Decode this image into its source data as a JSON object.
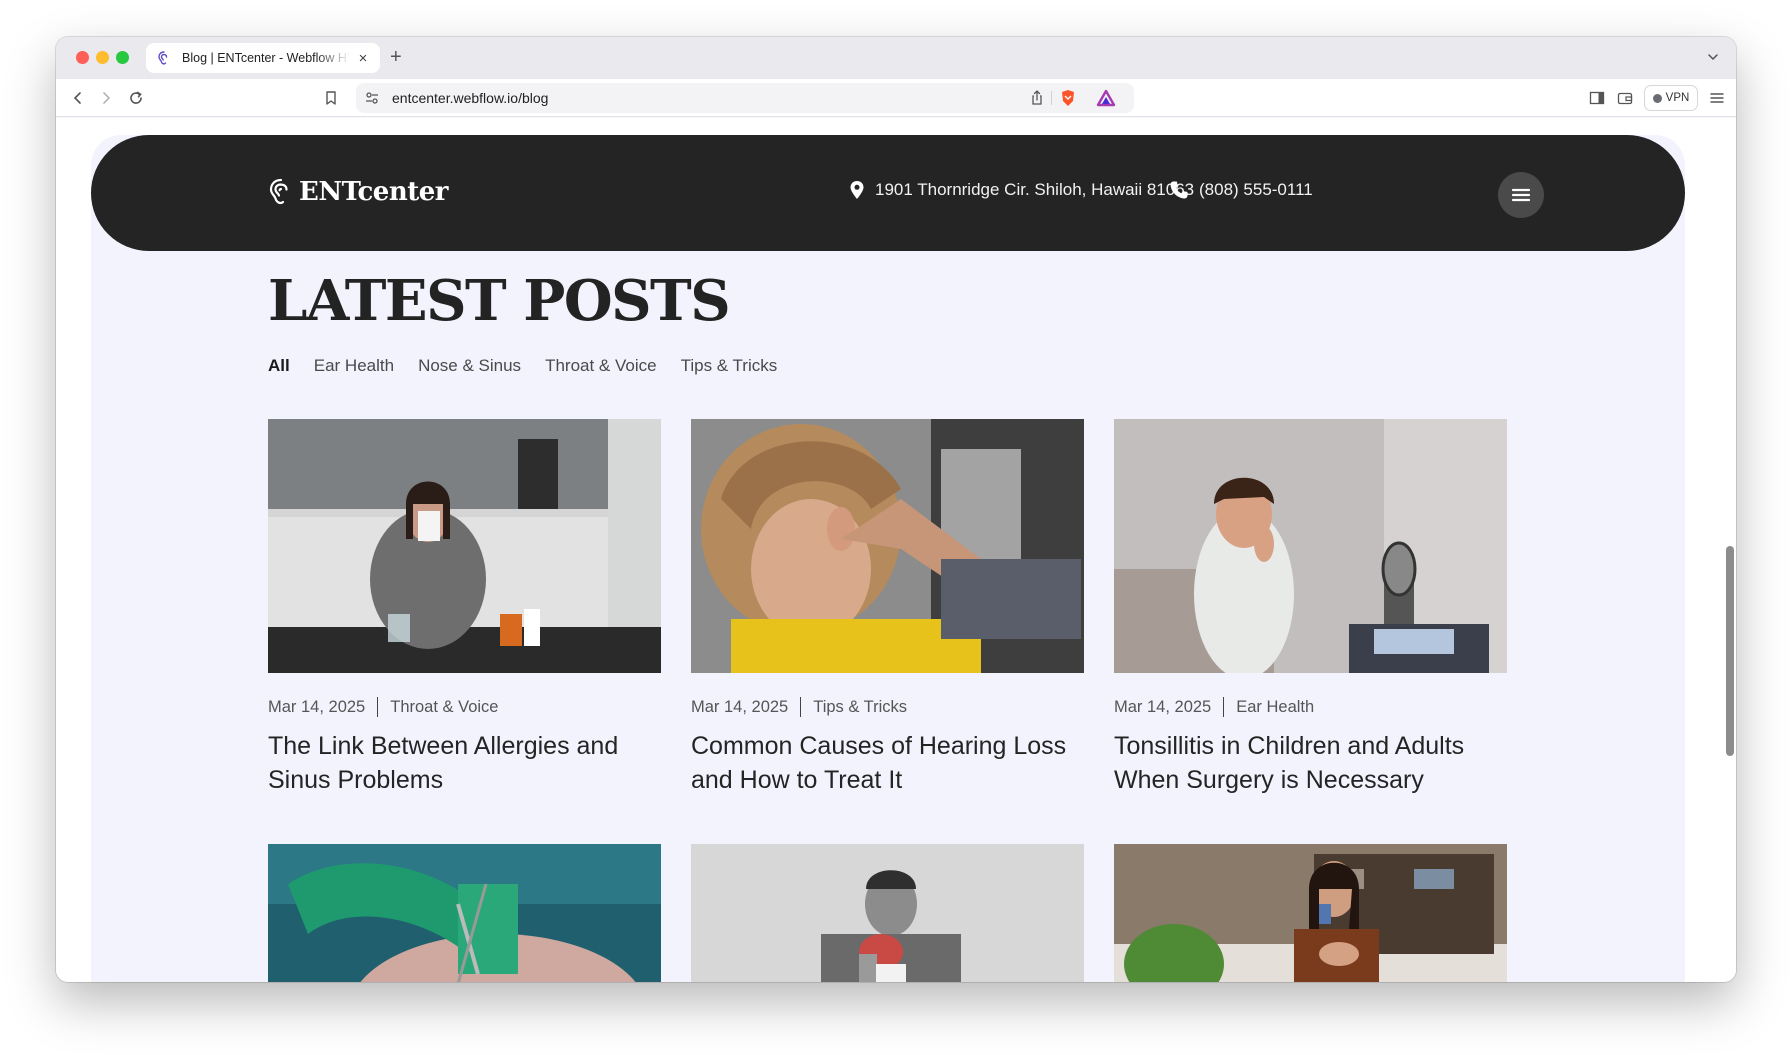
{
  "browser": {
    "tab_title": "Blog | ENTcenter - Webflow HTML website template",
    "url": "entcenter.webflow.io/blog",
    "vpn_label": "VPN"
  },
  "header": {
    "logo_text": "ENTcenter",
    "address": "1901 Thornridge Cir. Shiloh, Hawaii 81063",
    "phone": "(808) 555-0111"
  },
  "page": {
    "title": "LATEST POSTS"
  },
  "filters": [
    {
      "label": "All",
      "active": true
    },
    {
      "label": "Ear Health",
      "active": false
    },
    {
      "label": "Nose & Sinus",
      "active": false
    },
    {
      "label": "Throat & Voice",
      "active": false
    },
    {
      "label": "Tips & Tricks",
      "active": false
    }
  ],
  "posts": [
    {
      "date": "Mar 14, 2025",
      "category": "Throat & Voice",
      "title": "The Link Between Allergies and Sinus Problems"
    },
    {
      "date": "Mar 14, 2025",
      "category": "Tips & Tricks",
      "title": "Common Causes of Hearing Loss and How to Treat It"
    },
    {
      "date": "Mar 14, 2025",
      "category": "Ear Health",
      "title": "Tonsillitis in Children and Adults When Surgery is Necessary"
    }
  ],
  "colors": {
    "header_bg": "#242424",
    "page_bg": "#f3f3fe",
    "text_dark": "#242424"
  }
}
